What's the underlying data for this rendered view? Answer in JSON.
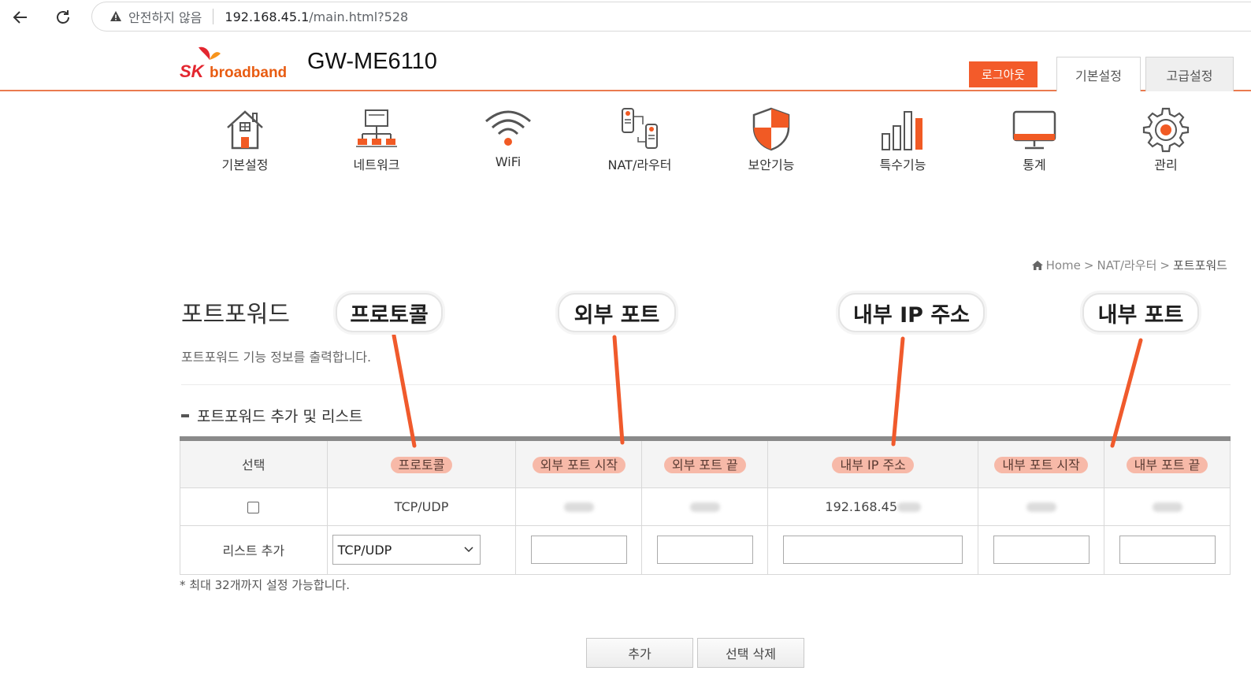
{
  "browser": {
    "security_text": "안전하지 않음",
    "url_host": "192.168.45.1",
    "url_path": "/main.html?528"
  },
  "header": {
    "logo_sk": "SK",
    "logo_broadband": "broadband",
    "model": "GW-ME6110",
    "logout": "로그아웃",
    "tab_basic": "기본설정",
    "tab_advanced": "고급설정"
  },
  "nav": {
    "items": [
      {
        "label": "기본설정",
        "icon": "home-icon"
      },
      {
        "label": "네트워크",
        "icon": "network-icon"
      },
      {
        "label": "WiFi",
        "icon": "wifi-icon"
      },
      {
        "label": "NAT/라우터",
        "icon": "router-icon"
      },
      {
        "label": "보안기능",
        "icon": "shield-icon"
      },
      {
        "label": "특수기능",
        "icon": "bar-chart-icon"
      },
      {
        "label": "통계",
        "icon": "monitor-icon"
      },
      {
        "label": "관리",
        "icon": "gear-icon"
      }
    ]
  },
  "breadcrumb": {
    "home": "Home",
    "sep": ">",
    "level1": "NAT/라우터",
    "level2": "포트포워드"
  },
  "page": {
    "title": "포트포워드",
    "description": "포트포워드 기능 정보를 출력합니다.",
    "section_title": "포트포워드 추가 및 리스트"
  },
  "table": {
    "headers": {
      "select": "선택",
      "protocol": "프로토콜",
      "ext_start": "외부 포트 시작",
      "ext_end": "외부 포트 끝",
      "internal_ip": "내부 IP 주소",
      "int_start": "내부 포트 시작",
      "int_end": "내부 포트 끝"
    },
    "row": {
      "protocol": "TCP/UDP",
      "internal_ip_prefix": "192.168.45"
    },
    "add_row": {
      "label": "리스트 추가",
      "protocol_selected": "TCP/UDP"
    }
  },
  "note": "* 최대 32개까지 설정 가능합니다.",
  "buttons": {
    "add": "추가",
    "delete_selected": "선택 삭제"
  },
  "annotations": {
    "protocol": "프로토콜",
    "external_port": "외부 포트",
    "internal_ip": "내부 IP 주소",
    "internal_port": "내부 포트"
  },
  "colors": {
    "brand_orange": "#f35b2a",
    "highlight": "#f7b9a8",
    "arrow": "#f05a2c"
  }
}
